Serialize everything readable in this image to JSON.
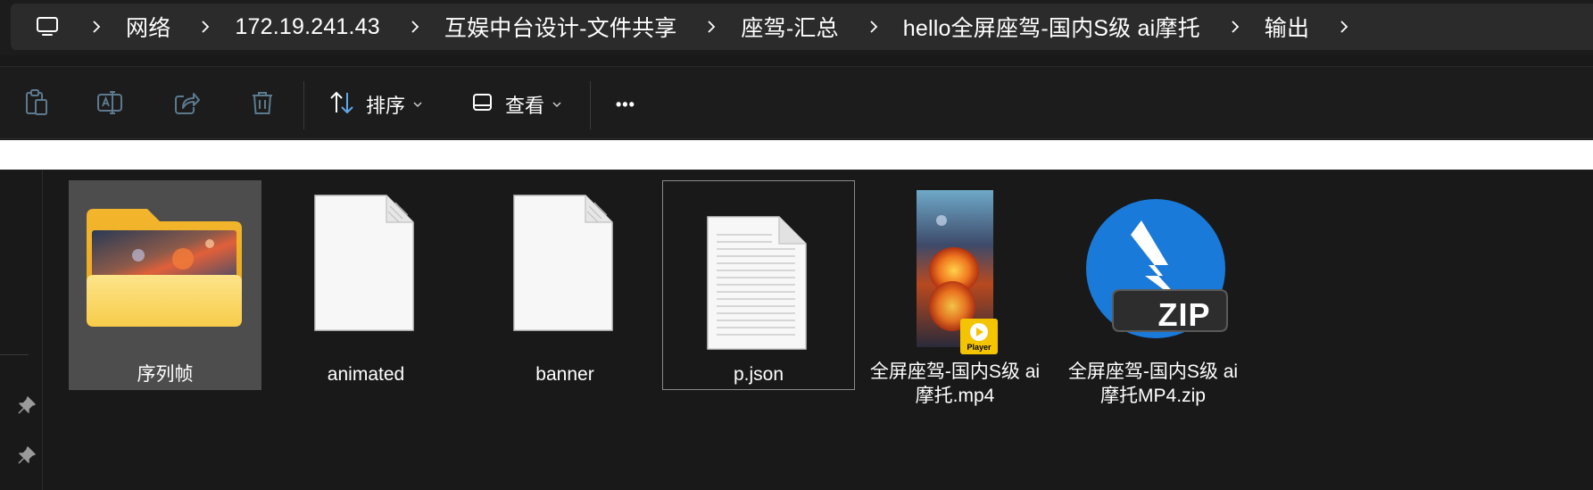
{
  "breadcrumb": {
    "items": [
      "网络",
      "172.19.241.43",
      "互娱中台设计-文件共享",
      "座驾-汇总",
      "hello全屏座驾-国内S级 ai摩托",
      "输出"
    ]
  },
  "toolbar": {
    "sort_label": "排序",
    "view_label": "查看",
    "more_label": "•••"
  },
  "files": [
    {
      "name": "序列帧",
      "type": "folder"
    },
    {
      "name": "animated",
      "type": "file"
    },
    {
      "name": "banner",
      "type": "file"
    },
    {
      "name": "p.json",
      "type": "text"
    },
    {
      "name": "全屏座驾-国内S级 ai\n摩托.mp4",
      "type": "video",
      "badge": "Player"
    },
    {
      "name": "全屏座驾-国内S级 ai\n摩托MP4.zip",
      "type": "zip",
      "badge": "ZIP"
    }
  ],
  "colors": {
    "accent": "#1a7ad9",
    "folder": "#f5c33b",
    "zip_bg": "#2d2d2d"
  }
}
